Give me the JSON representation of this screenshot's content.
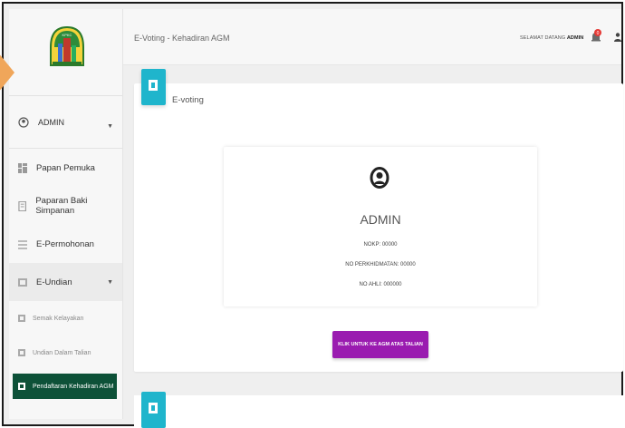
{
  "topbar": {
    "breadcrumb": "E-Voting - Kehadiran AGM",
    "greeting_prefix": "SELAMAT DATANG",
    "greeting_user": "ADMIN",
    "notification_count": "0"
  },
  "sidebar": {
    "user_name": "ADMIN",
    "items": [
      {
        "label": "Papan Pemuka",
        "icon": "dashboard-icon"
      },
      {
        "label": "Paparan Baki Simpanan",
        "icon": "document-icon"
      },
      {
        "label": "E-Permohonan",
        "icon": "list-icon"
      },
      {
        "label": "E-Undian",
        "icon": "vote-icon"
      }
    ],
    "sub_items": [
      {
        "label": "Semak Kelayakan"
      },
      {
        "label": "Undian Dalam Talian"
      },
      {
        "label": "Pendaftaran Kehadiran AGM"
      }
    ]
  },
  "card": {
    "title": "E-voting",
    "profile_name": "ADMIN",
    "nokp": "NOKP: 00000",
    "no_perkhidmatan": "NO PERKHIDMATAN: 00000",
    "no_ahli": "NO AHLI: 000000",
    "cta_label": "KLIK UNTUK KE AGM ATAS TALIAN"
  },
  "colors": {
    "accent_teal": "#1fb5cc",
    "cta_purple": "#9a1bb0",
    "active_green": "#0d5138",
    "notification_red": "#e53935"
  }
}
